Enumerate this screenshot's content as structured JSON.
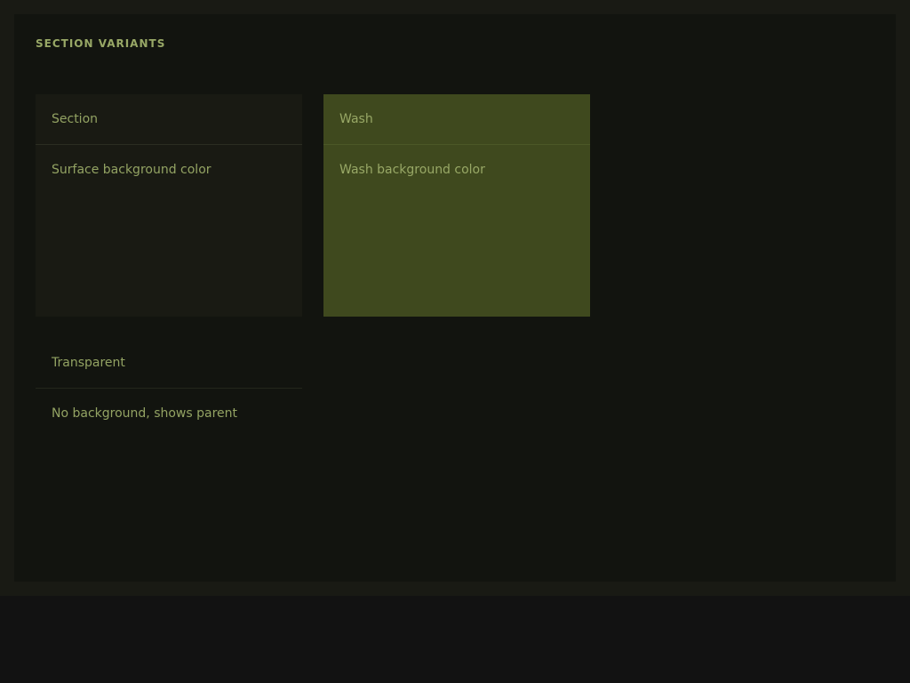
{
  "panel": {
    "title": "SECTION VARIANTS"
  },
  "variants": [
    {
      "label": "Section",
      "description": "Surface background color"
    },
    {
      "label": "Wash",
      "description": "Wash background color"
    },
    {
      "label": "Transparent",
      "description": "No background, shows parent"
    }
  ],
  "colors": {
    "surface": "#191a13",
    "wash": "#3f491e",
    "text": "#93a363",
    "panel_background": "#12140f"
  }
}
